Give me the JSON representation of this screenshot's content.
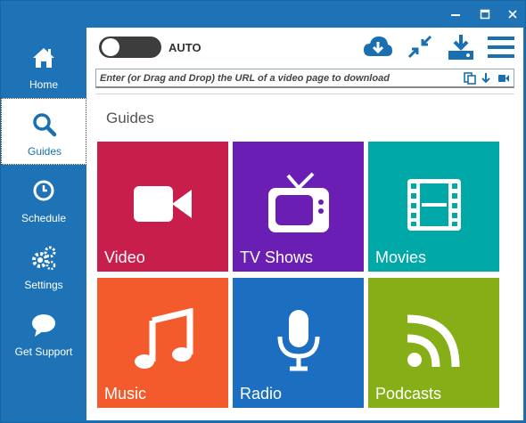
{
  "titlebar": {
    "min": "minimize",
    "max": "maximize",
    "close": "close"
  },
  "sidebar": {
    "items": [
      {
        "label": "Home",
        "icon": "home-icon"
      },
      {
        "label": "Guides",
        "icon": "search-icon",
        "active": true
      },
      {
        "label": "Schedule",
        "icon": "clock-icon"
      },
      {
        "label": "Settings",
        "icon": "gears-icon"
      },
      {
        "label": "Get Support",
        "icon": "chat-bubble-icon"
      }
    ]
  },
  "toolbar": {
    "auto_label": "AUTO",
    "auto_on": false,
    "icons": [
      "cloud-download-icon",
      "collapse-icon",
      "download-tray-icon",
      "menu-icon"
    ]
  },
  "url": {
    "placeholder": "Enter (or Drag and Drop) the URL of a video page to download",
    "actions": [
      "paste-icon",
      "download-arrow-icon",
      "video-camera-icon"
    ]
  },
  "guides": {
    "title": "Guides",
    "tiles": [
      {
        "label": "Video",
        "color": "#c81e4c",
        "icon": "video-camera-icon"
      },
      {
        "label": "TV Shows",
        "color": "#6a1eb4",
        "icon": "tv-icon"
      },
      {
        "label": "Movies",
        "color": "#00a8a8",
        "icon": "film-icon"
      },
      {
        "label": "Music",
        "color": "#f35a2c",
        "icon": "music-note-icon"
      },
      {
        "label": "Radio",
        "color": "#1c6fc0",
        "icon": "microphone-icon"
      },
      {
        "label": "Podcasts",
        "color": "#86ae17",
        "icon": "rss-icon"
      }
    ]
  },
  "colors": {
    "frame": "#1e73b6",
    "accent": "#1a6fb0"
  }
}
